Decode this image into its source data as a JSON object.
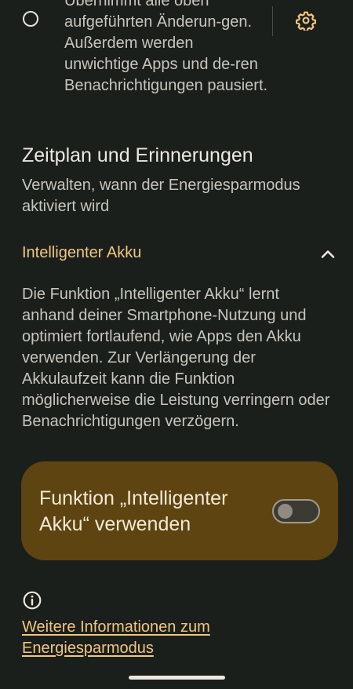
{
  "radio_option": {
    "description": "Übernimmt alle oben aufgeführten Änderun-gen. Außerdem werden unwichtige Apps und de-ren Benachrichtigungen pausiert."
  },
  "schedule": {
    "title": "Zeitplan und Erinnerungen",
    "subtitle": "Verwalten, wann der Energiesparmodus aktiviert wird"
  },
  "smart_battery": {
    "title": "Intelligenter Akku",
    "description": "Die Funktion „Intelligenter Akku“ lernt anhand deiner Smartphone-Nutzung und optimiert fortlaufend, wie Apps den Akku verwenden. Zur Verlängerung der Akkulaufzeit kann die Funktion möglicherweise die Leistung verringern oder Benachrichtigungen verzögern.",
    "toggle_label": "Funktion „Intelligenter Akku“ verwenden",
    "toggle_on": false
  },
  "footer": {
    "link_text": "Weitere Informationen zum Energiesparmodus"
  },
  "colors": {
    "background": "#1b1f1c",
    "accent": "#f0c780",
    "card": "#5d4411"
  }
}
